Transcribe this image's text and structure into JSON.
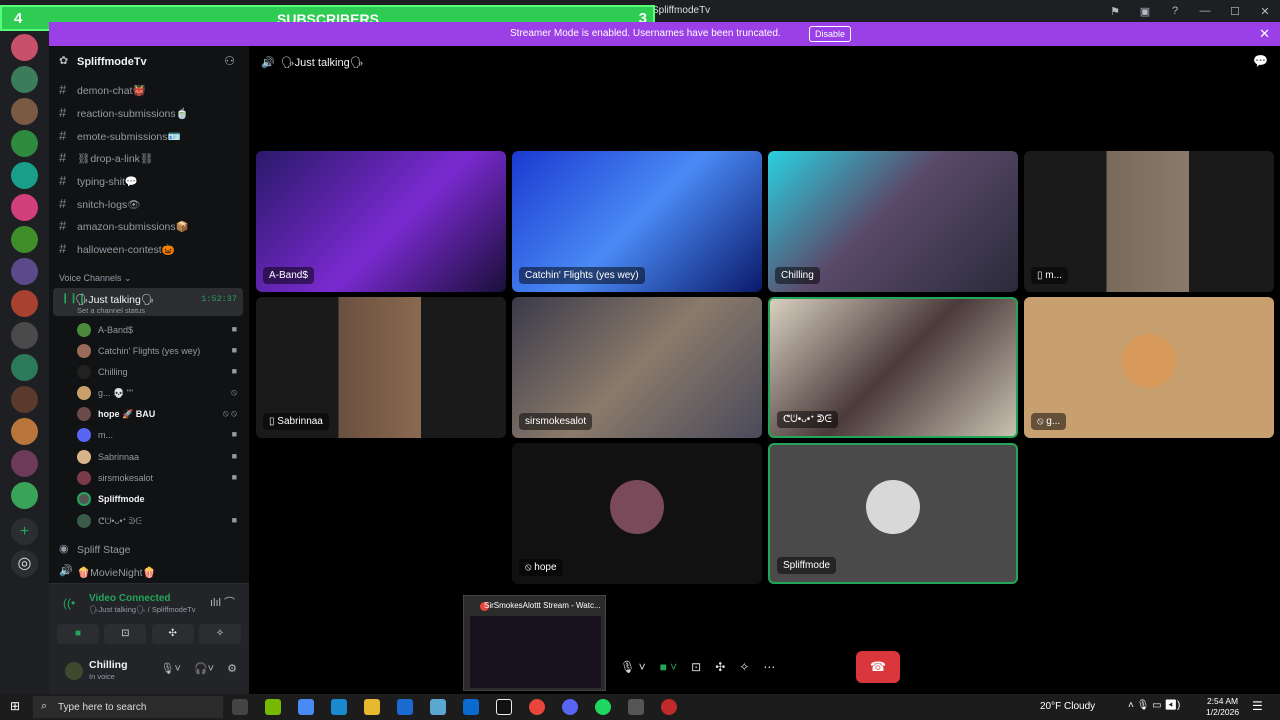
{
  "window": {
    "title": "SpliffmodeTv"
  },
  "overlay": {
    "left": "4",
    "label": "SUBSCRIBERS",
    "right": "3"
  },
  "notice": {
    "message": "Streamer Mode is enabled. Usernames have been truncated.",
    "button": "Disable"
  },
  "server": {
    "name": "SpliffmodeTv"
  },
  "text_channels": [
    "demon-chat👹",
    "reaction-submissions🍵",
    "emote-submissions🪪",
    "⛓drop-a-link⛓",
    "typing-shit💬",
    "snitch-logs👁",
    "amazon-submissions📦",
    "halloween-contest🎃"
  ],
  "voice_header": "Voice Channels",
  "voice_channel": {
    "name": "🗣Just talking🗣",
    "status": "Set a channel status",
    "timer": "1:52:37"
  },
  "voice_users": [
    {
      "name": "A-Band$",
      "icon": "camera-icon"
    },
    {
      "name": "Catchin' Flights (yes wey)",
      "icon": "camera-icon"
    },
    {
      "name": "Chilling",
      "icon": "camera-icon"
    },
    {
      "name": "g... 💀 \"\"",
      "icon": "muted-icon"
    },
    {
      "name": "hope 🚀 BAU",
      "icon": "muted-icon"
    },
    {
      "name": "m...",
      "icon": "camera-icon"
    },
    {
      "name": "Sabrinnaa",
      "icon": "camera-icon"
    },
    {
      "name": "sirsmokesalot",
      "icon": "camera-icon"
    },
    {
      "name": "Spliffmode",
      "icon": ""
    },
    {
      "name": "ᕦᕫ•ᴗ•ᕀ ᕲᕮ",
      "icon": "camera-icon"
    }
  ],
  "other_channels": [
    {
      "name": "Spliff Stage"
    },
    {
      "name": "🍿MovieNight🍿"
    }
  ],
  "panel": {
    "status": "Video Connected",
    "sub": "🗣Just talking🗣 / SpliffmodeTv",
    "user": "Chilling",
    "user_status": "In voice"
  },
  "main": {
    "channel_title": "🗣Just talking🗣"
  },
  "tiles": [
    {
      "label": "A-Band$"
    },
    {
      "label": "Catchin' Flights (yes wey)"
    },
    {
      "label": "Chilling"
    },
    {
      "label": "▯ m..."
    },
    {
      "label": "▯ Sabrinnaa"
    },
    {
      "label": "sirsmokesalot"
    },
    {
      "label": "ᕦᕫ•ᴗ•ᕀ ᕲᕮ"
    },
    {
      "label": "⦸ g..."
    },
    {
      "label": "⦸ hope"
    },
    {
      "label": "Spliffmode"
    }
  ],
  "thumbnail": {
    "title": "SirSmokesAlottt Stream - Watc..."
  },
  "taskbar": {
    "search": "Type here to search",
    "weather": "20°F  Cloudy",
    "time": "2:54 AM",
    "date": "1/2/2026"
  }
}
